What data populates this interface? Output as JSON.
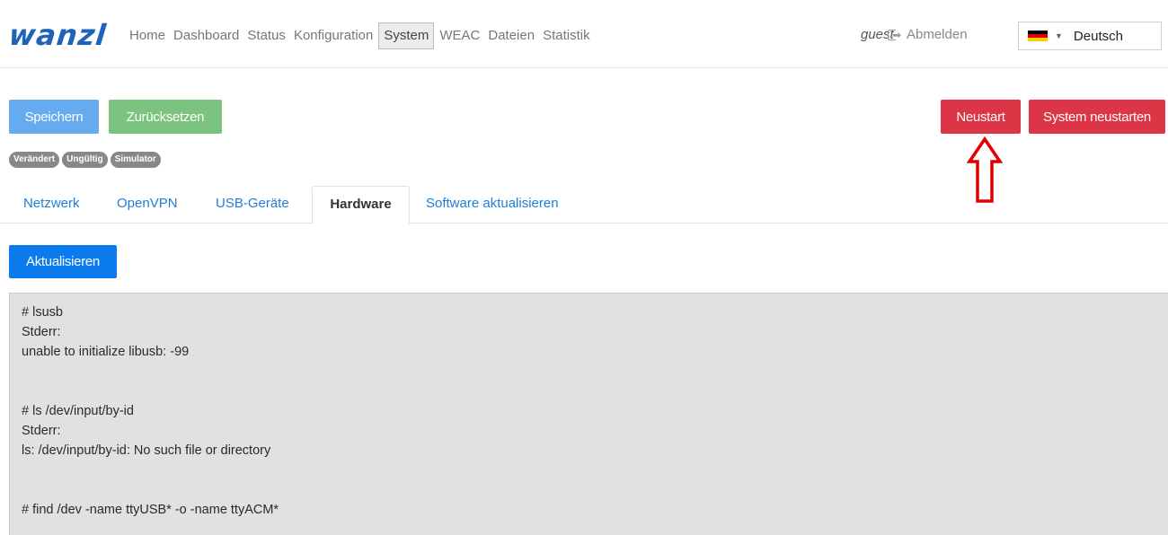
{
  "header": {
    "logo": "wanzl",
    "nav": [
      {
        "label": "Home"
      },
      {
        "label": "Dashboard"
      },
      {
        "label": "Status"
      },
      {
        "label": "Konfiguration"
      },
      {
        "label": "System",
        "active": true
      },
      {
        "label": "WEAC"
      },
      {
        "label": "Dateien"
      },
      {
        "label": "Statistik"
      }
    ],
    "user": "guest",
    "logout_label": "Abmelden",
    "language": {
      "selected": "Deutsch",
      "flag_colors": [
        "#000000",
        "#dd0000",
        "#ffce00"
      ]
    }
  },
  "actions": {
    "save": "Speichern",
    "reset": "Zurücksetzen",
    "restart": "Neustart",
    "system_restart": "System neustarten"
  },
  "badges": [
    "Verändert",
    "Ungültig",
    "Simulator"
  ],
  "tabs": [
    {
      "label": "Netzwerk"
    },
    {
      "label": "OpenVPN"
    },
    {
      "label": "USB-Geräte"
    },
    {
      "label": "Hardware",
      "active": true
    },
    {
      "label": "Software aktualisieren"
    }
  ],
  "hardware": {
    "refresh_label": "Aktualisieren",
    "output_lines": [
      "# lsusb",
      "Stderr:",
      "unable to initialize libusb: -99",
      "",
      "",
      "# ls /dev/input/by-id",
      "Stderr:",
      "ls: /dev/input/by-id: No such file or directory",
      "",
      "",
      "# find /dev -name ttyUSB* -o -name ttyACM*"
    ]
  },
  "colors": {
    "brand": "#1f63b6",
    "primary": "#0d7bf0",
    "primary_light": "#66aaf0",
    "success": "#7cc37f",
    "danger": "#dc3545",
    "annotation": "#e00000"
  },
  "icons": [
    "logout-icon",
    "chevron-down-icon",
    "german-flag-icon",
    "up-arrow-annotation-icon"
  ]
}
